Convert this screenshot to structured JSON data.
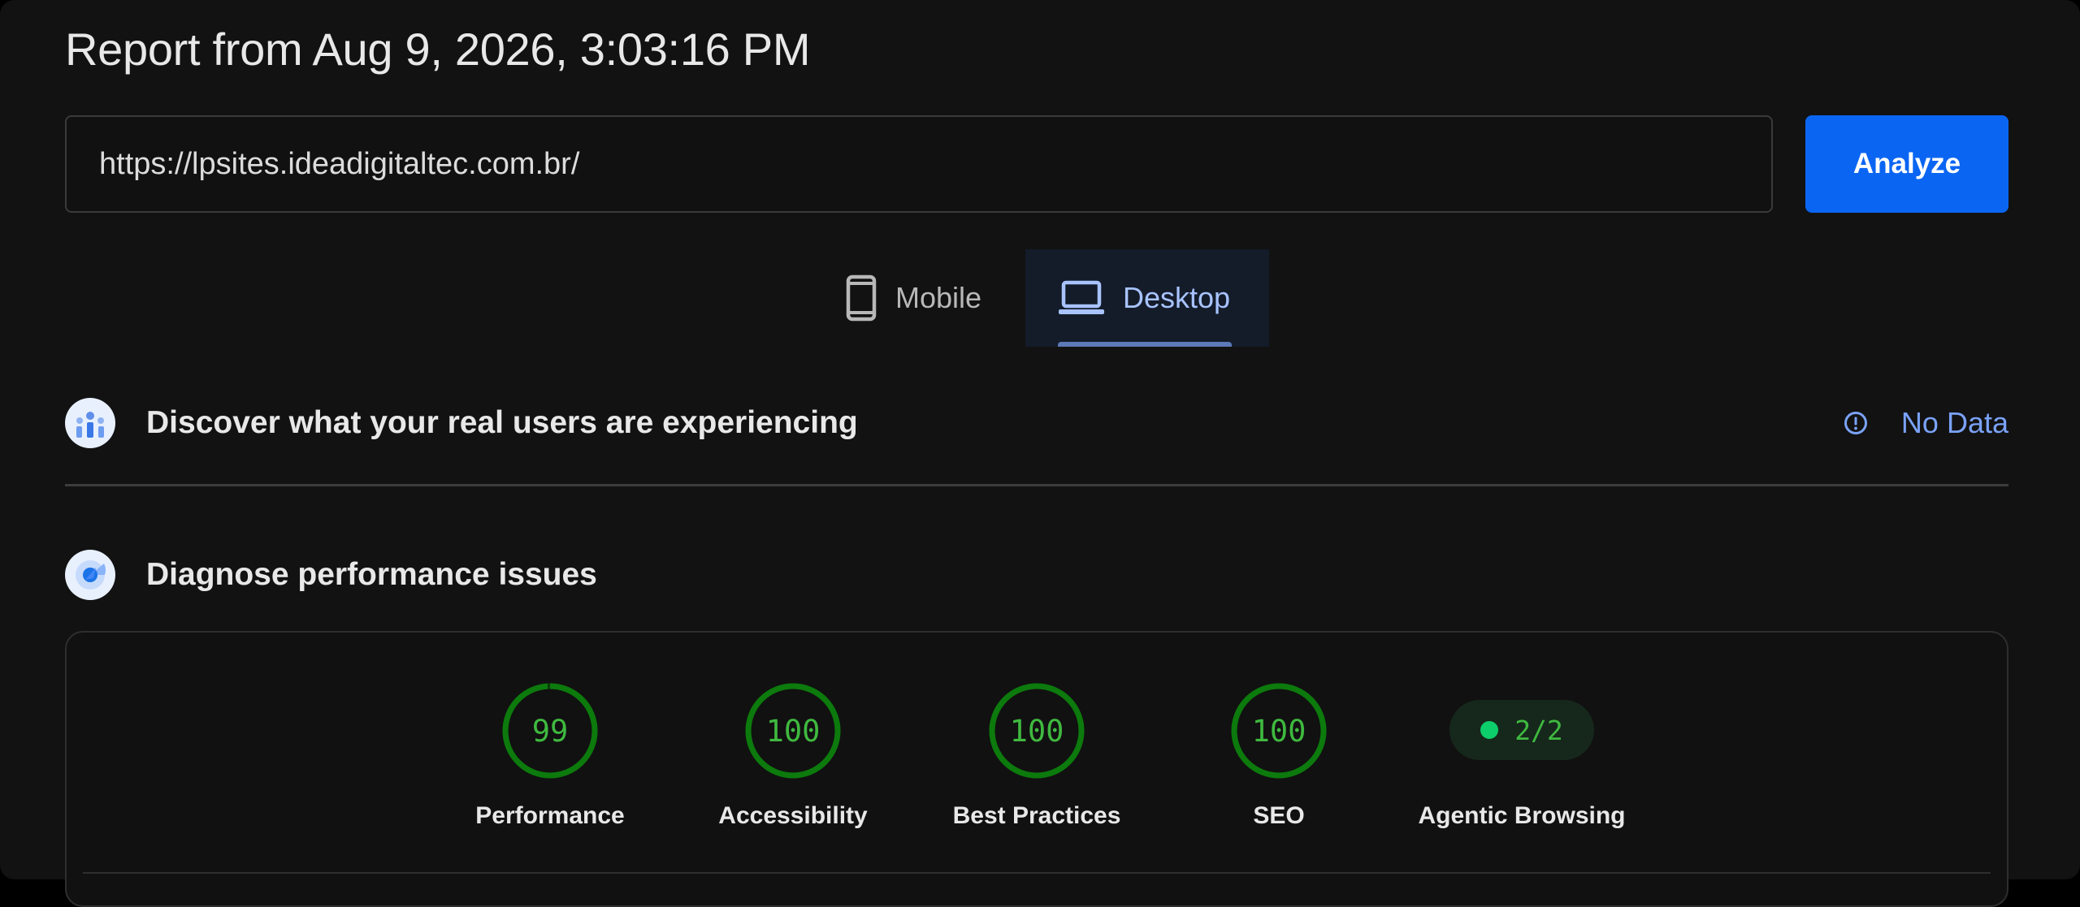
{
  "report": {
    "title": "Report from Aug 9, 2026, 3:03:16 PM"
  },
  "url_input": {
    "value": "https://lpsites.ideadigitaltec.com.br/"
  },
  "analyze_button": {
    "label": "Analyze"
  },
  "device_tabs": [
    {
      "label": "Mobile",
      "icon": "phone-icon",
      "selected": false
    },
    {
      "label": "Desktop",
      "icon": "laptop-icon",
      "selected": true
    }
  ],
  "field_data": {
    "title": "Discover what your real users are experiencing",
    "icon": "users-chart-icon",
    "status_icon": "info-icon",
    "status": "No Data"
  },
  "lab_data": {
    "title": "Diagnose performance issues",
    "icon": "lighthouse-icon"
  },
  "scores": [
    {
      "label": "Performance",
      "value": 99,
      "display": "99"
    },
    {
      "label": "Accessibility",
      "value": 100,
      "display": "100"
    },
    {
      "label": "Best Practices",
      "value": 100,
      "display": "100"
    },
    {
      "label": "SEO",
      "value": 100,
      "display": "100"
    }
  ],
  "agentic": {
    "label": "Agentic Browsing",
    "value": "2/2"
  },
  "colors": {
    "accent": "#0b65f3",
    "pass_green": "#0cce6b",
    "score_text": "#3fb93f",
    "link_blue": "#7aa2f7",
    "background": "#121212"
  }
}
